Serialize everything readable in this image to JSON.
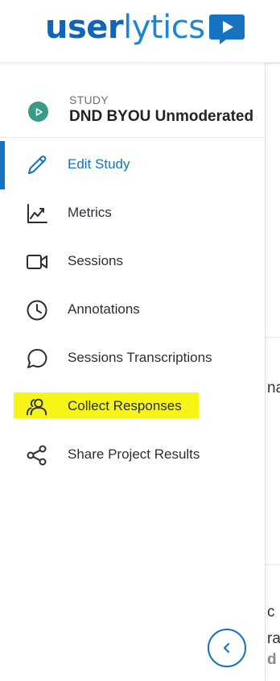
{
  "brand": {
    "logo_part1": "user",
    "logo_part2": "lytics"
  },
  "study": {
    "kicker": "STUDY",
    "name": "DND BYOU Unmoderated"
  },
  "nav": [
    {
      "label": "Edit Study",
      "icon": "pencil-icon",
      "active": true
    },
    {
      "label": "Metrics",
      "icon": "chart-line-icon"
    },
    {
      "label": "Sessions",
      "icon": "video-camera-icon"
    },
    {
      "label": "Annotations",
      "icon": "clock-icon"
    },
    {
      "label": "Sessions Transcriptions",
      "icon": "speech-bubble-icon"
    },
    {
      "label": "Collect Responses",
      "icon": "users-icon",
      "highlighted": true
    },
    {
      "label": "Share Project Results",
      "icon": "share-icon"
    }
  ],
  "background_fragments": {
    "frag1": "na",
    "frag2": "c",
    "frag3": "ra",
    "frag4": "d"
  },
  "colors": {
    "brand_blue": "#0f66b8",
    "active_blue": "#1573c2",
    "highlight_yellow": "#f7f417",
    "study_icon_green": "#3a9a8a"
  }
}
